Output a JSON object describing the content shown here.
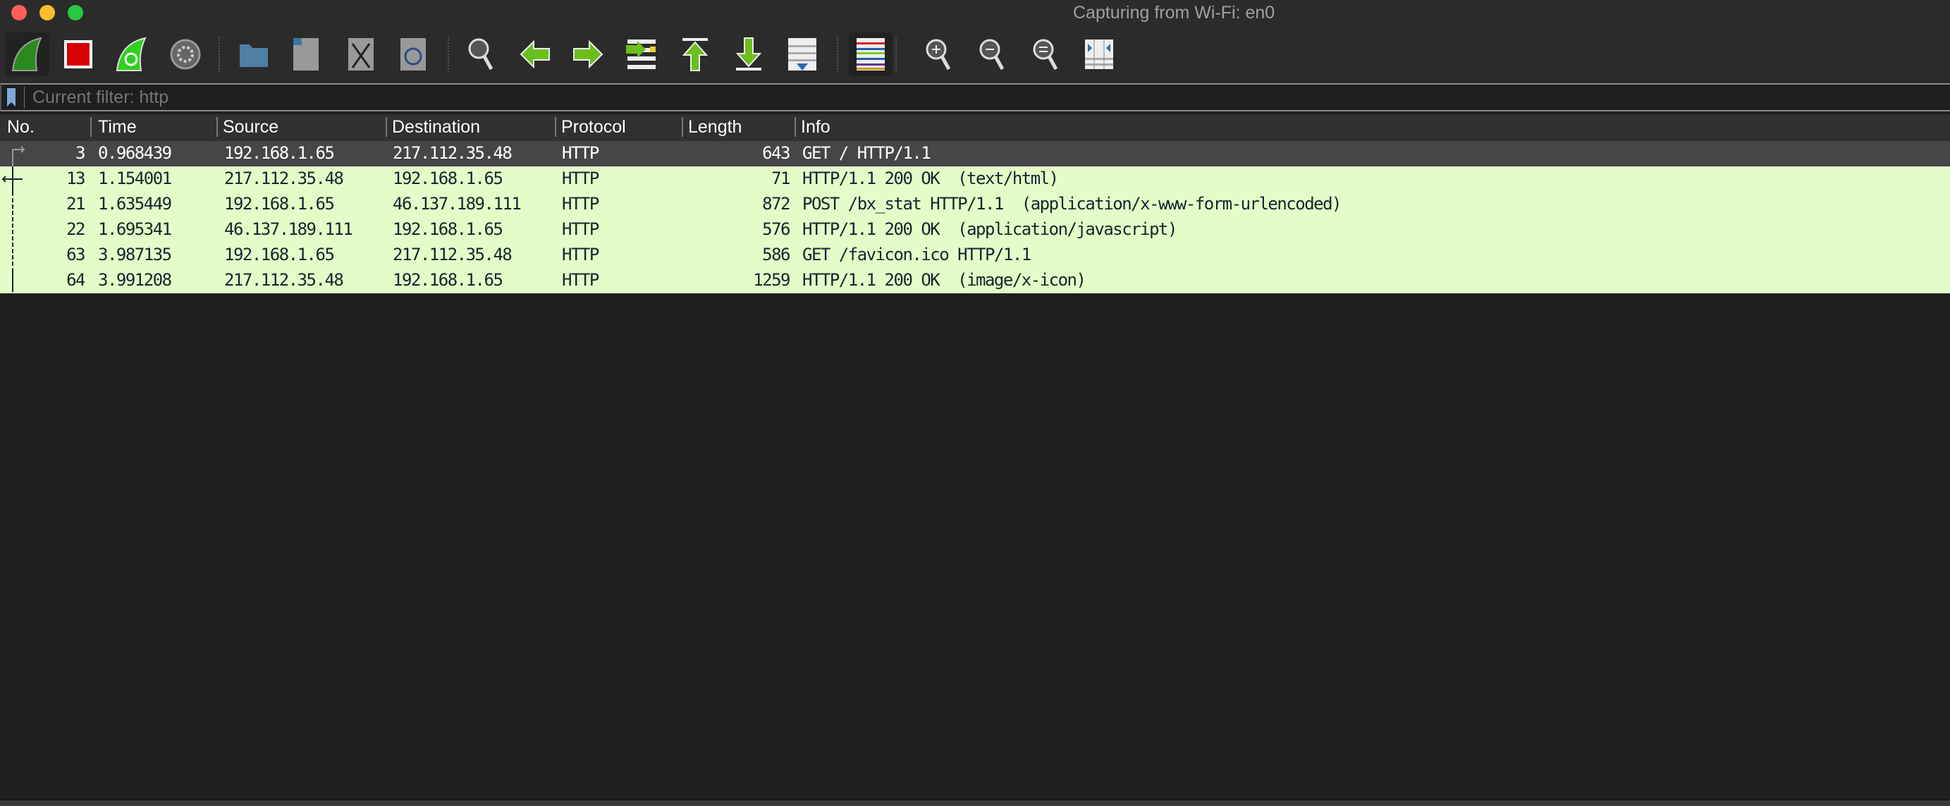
{
  "window": {
    "title": "Capturing from Wi-Fi: en0"
  },
  "toolbar": {
    "buttons": [
      {
        "name": "start-capture",
        "icon": "shark-fin-icon"
      },
      {
        "name": "stop-capture",
        "icon": "stop-icon"
      },
      {
        "name": "restart-capture",
        "icon": "restart-fin-icon"
      },
      {
        "name": "capture-options",
        "icon": "gear-icon"
      },
      {
        "name": "open-file",
        "icon": "folder-icon"
      },
      {
        "name": "save-file",
        "icon": "binary-file-icon"
      },
      {
        "name": "close-file",
        "icon": "close-file-icon"
      },
      {
        "name": "reload-file",
        "icon": "reload-file-icon"
      },
      {
        "name": "find-packet",
        "icon": "magnifier-icon"
      },
      {
        "name": "go-back",
        "icon": "arrow-left-icon"
      },
      {
        "name": "go-forward",
        "icon": "arrow-right-icon"
      },
      {
        "name": "go-to-packet",
        "icon": "go-to-packet-icon"
      },
      {
        "name": "go-first-packet",
        "icon": "arrow-up-top-icon"
      },
      {
        "name": "go-last-packet",
        "icon": "arrow-down-bottom-icon"
      },
      {
        "name": "auto-scroll",
        "icon": "auto-scroll-icon"
      },
      {
        "name": "colorize",
        "icon": "colorize-icon"
      },
      {
        "name": "zoom-in",
        "icon": "zoom-in-icon"
      },
      {
        "name": "zoom-out",
        "icon": "zoom-out-icon"
      },
      {
        "name": "normal-size",
        "icon": "zoom-reset-icon"
      },
      {
        "name": "resize-columns",
        "icon": "resize-columns-icon"
      }
    ]
  },
  "filter": {
    "placeholder": "Current filter: http",
    "value": ""
  },
  "table": {
    "columns": [
      "No.",
      "Time",
      "Source",
      "Destination",
      "Protocol",
      "Length",
      "Info"
    ],
    "rows": [
      {
        "no": "3",
        "time": "0.968439",
        "source": "192.168.1.65",
        "destination": "217.112.35.48",
        "protocol": "HTTP",
        "length": "643",
        "info": "GET / HTTP/1.1",
        "selected": true
      },
      {
        "no": "13",
        "time": "1.154001",
        "source": "217.112.35.48",
        "destination": "192.168.1.65",
        "protocol": "HTTP",
        "length": "71",
        "info": "HTTP/1.1 200 OK  (text/html)"
      },
      {
        "no": "21",
        "time": "1.635449",
        "source": "192.168.1.65",
        "destination": "46.137.189.111",
        "protocol": "HTTP",
        "length": "872",
        "info": "POST /bx_stat HTTP/1.1  (application/x-www-form-urlencoded)"
      },
      {
        "no": "22",
        "time": "1.695341",
        "source": "46.137.189.111",
        "destination": "192.168.1.65",
        "protocol": "HTTP",
        "length": "576",
        "info": "HTTP/1.1 200 OK  (application/javascript)"
      },
      {
        "no": "63",
        "time": "3.987135",
        "source": "192.168.1.65",
        "destination": "217.112.35.48",
        "protocol": "HTTP",
        "length": "586",
        "info": "GET /favicon.ico HTTP/1.1"
      },
      {
        "no": "64",
        "time": "3.991208",
        "source": "217.112.35.48",
        "destination": "192.168.1.65",
        "protocol": "HTTP",
        "length": "1259",
        "info": "HTTP/1.1 200 OK  (image/x-icon)"
      }
    ]
  },
  "colors": {
    "http_row": "#e4fdc8",
    "selected_row": "#464646",
    "background": "#1f1f1f"
  }
}
